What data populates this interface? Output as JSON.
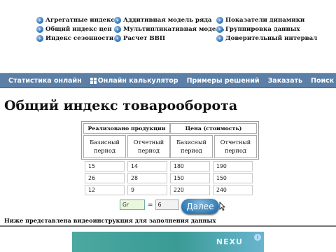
{
  "links": [
    {
      "label": "Агрегатные индексы"
    },
    {
      "label": "Аддитивная модель ряда"
    },
    {
      "label": "Показатели динамики"
    },
    {
      "label": "Общий индекс цен"
    },
    {
      "label": "Мультипликативная модель"
    },
    {
      "label": "Группировка данных"
    },
    {
      "label": "Индекс сезонности"
    },
    {
      "label": "Расчет ВВП"
    },
    {
      "label": "Доверительный интервал"
    }
  ],
  "nav": {
    "items": [
      {
        "label": "Статистика онлайн"
      },
      {
        "label": "Онлайн калькулятор"
      },
      {
        "label": "Примеры решений"
      },
      {
        "label": "Заказать"
      },
      {
        "label": "Поиск"
      }
    ]
  },
  "page_title": "Общий индекс товарооборота",
  "table": {
    "group1": "Реализовано продукции",
    "group2": "Цена (стоимость)",
    "base_period": "Базисный период",
    "report_period": "Отчетный период",
    "rows": [
      [
        "15",
        "14",
        "180",
        "190"
      ],
      [
        "26",
        "28",
        "150",
        "150"
      ],
      [
        "12",
        "9",
        "220",
        "240"
      ]
    ]
  },
  "controls": {
    "groups_label": "Gr",
    "equals": "=",
    "groups_value": "6",
    "next_label": "Далее"
  },
  "note": "Ниже представлена видеоинструкция для заполнения данных",
  "banner": {
    "text": "NEXU",
    "ad_icon": "i"
  },
  "colors": {
    "navbar": "#5b7fa6",
    "button": "#2b77b3",
    "groups_box": "#e9f7dc"
  }
}
